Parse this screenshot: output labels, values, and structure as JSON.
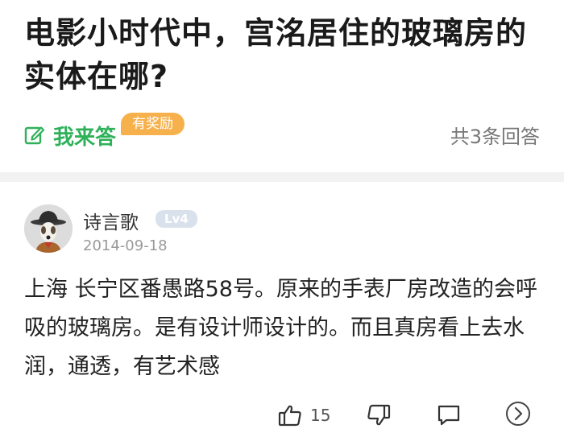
{
  "question": {
    "title": "电影小时代中，宫洺居住的玻璃房的实体在哪?",
    "answer_label": "我来答",
    "reward_badge": "有奖励",
    "answer_count": "共3条回答"
  },
  "answer": {
    "author_name": "诗言歌",
    "level": "Lv4",
    "date": "2014-09-18",
    "body": "上海 长宁区番愚路58号。原来的手表厂房改造的会呼吸的玻璃房。是有设计师设计的。而且真房看上去水润，通透，有艺术感"
  },
  "actions": {
    "like_count": "15"
  },
  "colors": {
    "accent_green": "#2fb15a",
    "reward_orange": "#f7b14c",
    "level_badge": "#d9e2ec",
    "divider": "#f2f2f2"
  },
  "icons": [
    "edit-icon",
    "thumbs-up-icon",
    "thumbs-down-icon",
    "comment-icon",
    "chevron-right-icon"
  ]
}
